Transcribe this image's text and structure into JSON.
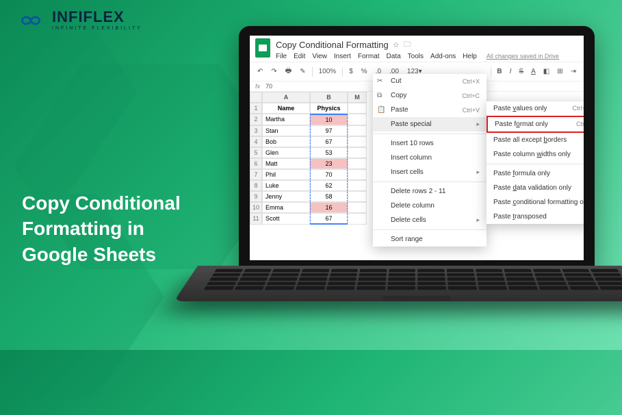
{
  "brand": {
    "name": "INFIFLEX",
    "tagline": "INFINITE FLEXIBILITY"
  },
  "caption": "Copy Conditional Formatting in Google Sheets",
  "sheets": {
    "doc_title": "Copy Conditional Formatting",
    "menu": {
      "file": "File",
      "edit": "Edit",
      "view": "View",
      "insert": "Insert",
      "format": "Format",
      "data": "Data",
      "tools": "Tools",
      "addons": "Add-ons",
      "help": "Help",
      "saved": "All changes saved in Drive"
    },
    "toolbar": {
      "zoom": "100%",
      "currency": "$",
      "percent": "%",
      "dec_dec": ".0←",
      "dec_inc": ".00→",
      "more": "123▾",
      "b": "B",
      "i": "I",
      "s": "S",
      "a": "A"
    },
    "fx": {
      "label": "fx",
      "value": "70"
    },
    "cols": {
      "a": "A",
      "b": "B",
      "c": "M"
    },
    "headers": {
      "name": "Name",
      "physics": "Physics"
    },
    "rows": [
      {
        "n": "1"
      },
      {
        "n": "2",
        "name": "Martha",
        "val": "10",
        "hl": true
      },
      {
        "n": "3",
        "name": "Stan",
        "val": "97"
      },
      {
        "n": "4",
        "name": "Bob",
        "val": "67"
      },
      {
        "n": "5",
        "name": "Glen",
        "val": "53"
      },
      {
        "n": "6",
        "name": "Matt",
        "val": "23",
        "hl": true
      },
      {
        "n": "7",
        "name": "Phil",
        "val": "70"
      },
      {
        "n": "8",
        "name": "Luke",
        "val": "62"
      },
      {
        "n": "9",
        "name": "Jenny",
        "val": "58"
      },
      {
        "n": "10",
        "name": "Emma",
        "val": "16",
        "hl": true
      },
      {
        "n": "11",
        "name": "Scott",
        "val": "67"
      }
    ],
    "context_menu": {
      "cut": {
        "label": "Cut",
        "shortcut": "Ctrl+X"
      },
      "copy": {
        "label": "Copy",
        "shortcut": "Ctrl+C"
      },
      "paste": {
        "label": "Paste",
        "shortcut": "Ctrl+V"
      },
      "paste_special": {
        "label": "Paste special"
      },
      "insert_rows": "Insert 10 rows",
      "insert_column": "Insert column",
      "insert_cells": "Insert cells",
      "delete_rows": "Delete rows 2 - 11",
      "delete_column": "Delete column",
      "delete_cells": "Delete cells",
      "sort_range": "Sort range"
    },
    "paste_special_menu": {
      "values": {
        "label": "Paste values only",
        "shortcut": "Ctrl+Shift+V"
      },
      "format": {
        "label": "Paste format only",
        "shortcut": "Ctrl+Alt+V"
      },
      "borders": "Paste all except borders",
      "widths": "Paste column widths only",
      "formula": "Paste formula only",
      "validation": "Paste data validation only",
      "cond": "Paste conditional formatting only",
      "transposed": "Paste transposed"
    }
  }
}
